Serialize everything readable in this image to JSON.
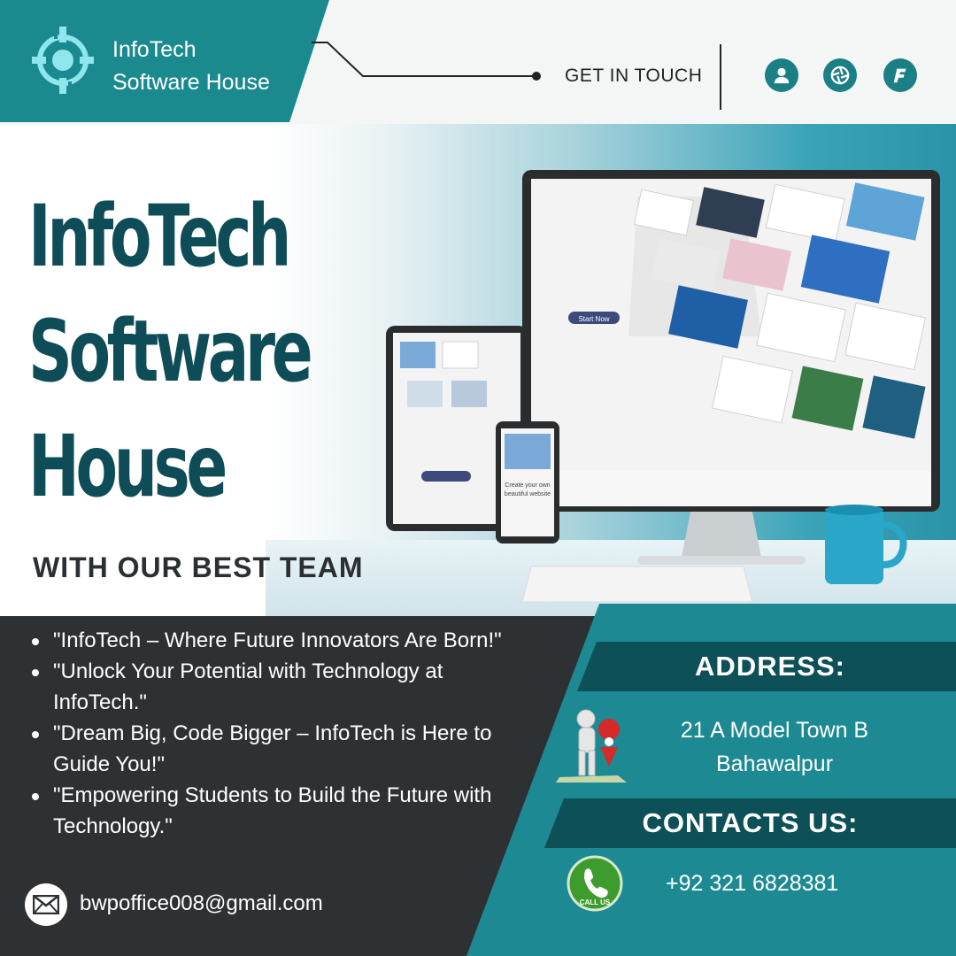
{
  "header": {
    "brand_line1": "InfoTech",
    "brand_line2": "Software House",
    "get_in_touch": "GET IN TOUCH",
    "social_icons": [
      "user-icon",
      "camera-aperture-icon",
      "f-icon"
    ]
  },
  "hero": {
    "title_line1": "InfoTech",
    "title_line2": "Software",
    "title_line3": "House",
    "subtitle": "WITH OUR BEST TEAM",
    "screen_button": "Start Now",
    "phone_text_line1": "Create your own",
    "phone_text_line2": "beautiful website"
  },
  "quotes": [
    "\"InfoTech – Where Future Innovators Are Born!\"",
    "\"Unlock Your Potential with Technology at InfoTech.\"",
    "\"Dream Big, Code Bigger – InfoTech is Here to Guide You!\"",
    "\"Empowering Students to Build the Future with Technology.\""
  ],
  "contact": {
    "email": "bwpoffice008@gmail.com",
    "address_heading": "ADDRESS:",
    "address_line1": "21 A Model Town B",
    "address_line2": "Bahawalpur",
    "contacts_heading": "CONTACTS US:",
    "phone": "+92 321 6828381",
    "call_badge": "CALL US"
  },
  "colors": {
    "teal": "#1b8a8f",
    "dark_teal": "#0e4d57",
    "charcoal": "#2e3133"
  }
}
